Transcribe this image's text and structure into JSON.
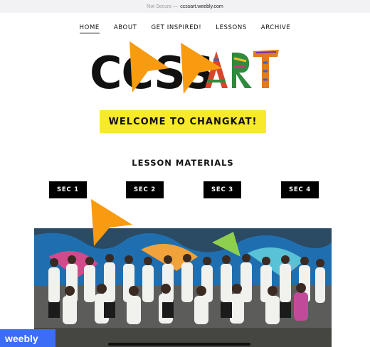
{
  "browser": {
    "security_label": "Not Secure —",
    "host": "ccssart.weebly.com"
  },
  "nav": {
    "items": [
      "HOME",
      "ABOUT",
      "GET INSPIRED!",
      "LESSONS",
      "ARCHIVE"
    ],
    "active": "HOME"
  },
  "logo": {
    "text_left": "CCSS",
    "text_right": "ART"
  },
  "welcome_text": "WELCOME TO CHANGKAT!",
  "lesson_heading": "LESSON MATERIALS",
  "sections": [
    "SEC 1",
    "SEC 2",
    "SEC 3",
    "SEC 4"
  ],
  "badge": "weebly",
  "colors": {
    "accent_yellow": "#f6ea2b",
    "badge_blue": "#3b6ef5",
    "pointer_orange": "#f89b10"
  }
}
